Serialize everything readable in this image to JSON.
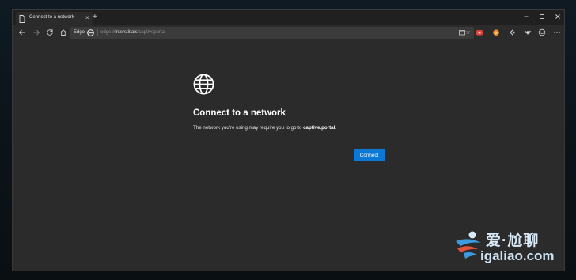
{
  "browser": {
    "tab_title": "Connect to a network",
    "tab_close_glyph": "×",
    "new_tab_glyph": "+",
    "edge_chip_label": "Edge",
    "url_prefix": "edge://",
    "url_host": "interstitials",
    "url_path": "/captiveportal",
    "favorite_glyph": "☆",
    "icons": {
      "back": "arrow-left-icon",
      "forward": "arrow-right-icon",
      "refresh": "refresh-icon",
      "home": "home-icon",
      "favorite": "star-icon",
      "window_controls": [
        "minimize-icon",
        "maximize-icon",
        "close-icon"
      ],
      "extensions": [
        "collections-icon",
        "pocket-icon",
        "fox-icon",
        "browser-icon",
        "bat-icon",
        "emoji-icon",
        "more-icon"
      ]
    }
  },
  "page": {
    "heading": "Connect to a network",
    "description_prefix": "The network you're using may require you to go to ",
    "description_link": "captive.portal",
    "description_suffix": ".",
    "connect_label": "Connect",
    "icon": "globe-icon"
  },
  "watermark": {
    "title": "爱·尬聊",
    "url": "igaliao.com"
  },
  "colors": {
    "accent": "#0a78d4",
    "content_bg": "#2b2b2b",
    "tabstrip_bg": "#202020"
  }
}
